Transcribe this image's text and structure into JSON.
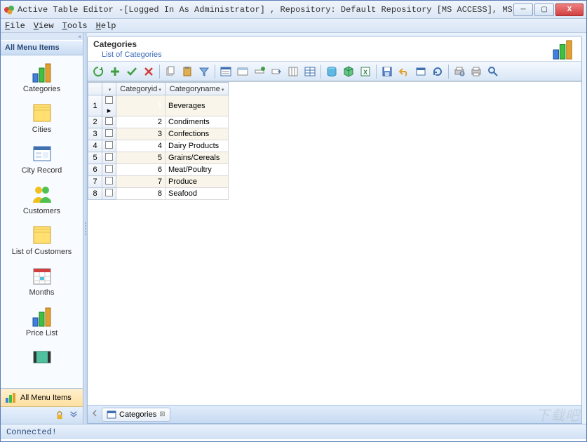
{
  "window": {
    "title": "Active Table Editor -[Logged In As Administrator] , Repository: Default Repository [MS ACCESS], MS Access, C:\\Doc..."
  },
  "menu": {
    "file": "File",
    "view": "View",
    "tools": "Tools",
    "help": "Help"
  },
  "sidebar": {
    "header": "All Menu Items",
    "items": [
      {
        "label": "Categories",
        "icon": "barchart"
      },
      {
        "label": "Cities",
        "icon": "note"
      },
      {
        "label": "City Record",
        "icon": "form"
      },
      {
        "label": "Customers",
        "icon": "people"
      },
      {
        "label": "List of Customers",
        "icon": "note"
      },
      {
        "label": "Months",
        "icon": "calendar"
      },
      {
        "label": "Price List",
        "icon": "barchart"
      }
    ],
    "bottom_btn": "All Menu Items"
  },
  "content": {
    "title": "Categories",
    "subtitle": "List of Categories",
    "columns": [
      "",
      "Categoryid",
      "Categoryname"
    ],
    "rows": [
      {
        "n": 1,
        "id": "1",
        "name": "Beverages",
        "selected": true
      },
      {
        "n": 2,
        "id": "2",
        "name": "Condiments"
      },
      {
        "n": 3,
        "id": "3",
        "name": "Confections"
      },
      {
        "n": 4,
        "id": "4",
        "name": "Dairy Products"
      },
      {
        "n": 5,
        "id": "5",
        "name": "Grains/Cereals"
      },
      {
        "n": 6,
        "id": "6",
        "name": "Meat/Poultry"
      },
      {
        "n": 7,
        "id": "7",
        "name": "Produce"
      },
      {
        "n": 8,
        "id": "8",
        "name": "Seafood"
      }
    ],
    "tab": "Categories"
  },
  "status": "Connected!"
}
